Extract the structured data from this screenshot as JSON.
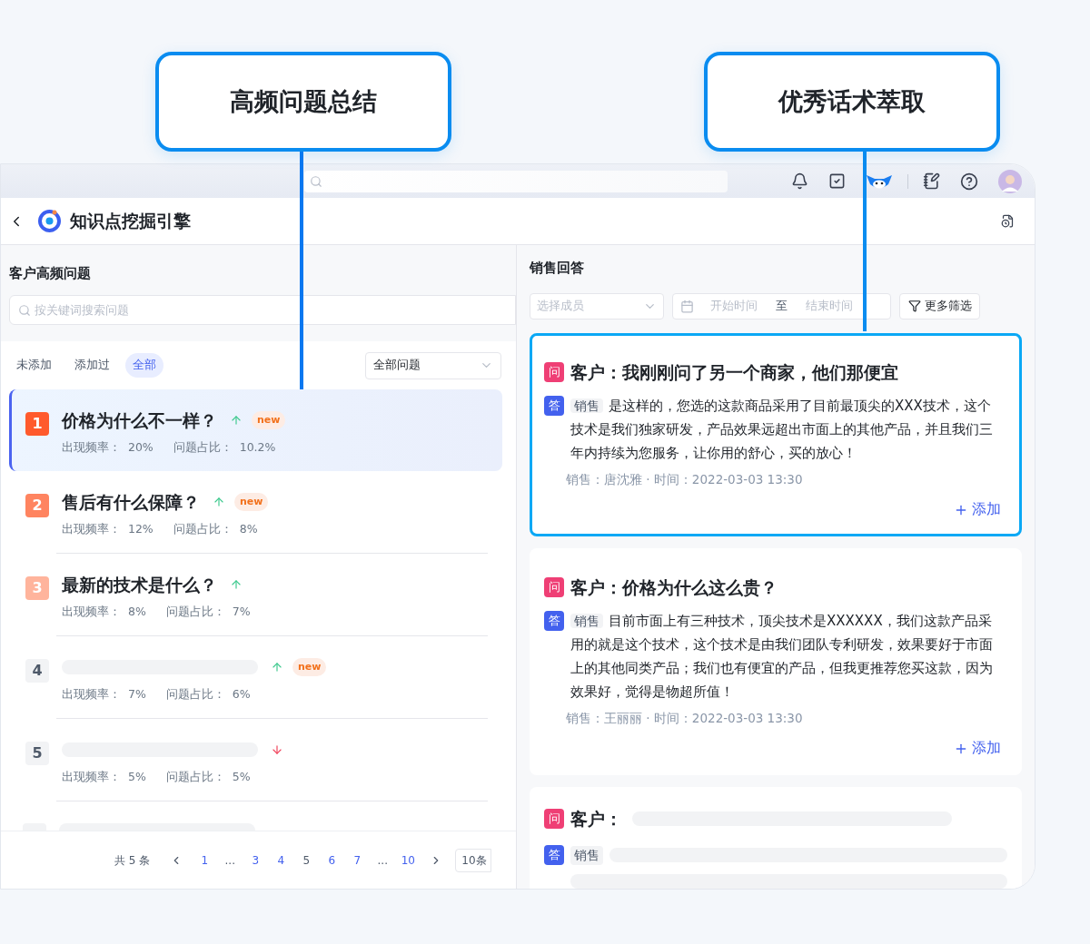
{
  "callouts": [
    {
      "label": "高频问题总结"
    },
    {
      "label": "优秀话术萃取"
    }
  ],
  "app_header": {
    "title": "知识点挖掘引擎"
  },
  "questions_panel": {
    "title": "客户高频问题",
    "search": {
      "placeholder": "按关键词搜索问题"
    },
    "tabs": [
      {
        "label": "未添加",
        "selected": false
      },
      {
        "label": "添加过",
        "selected": false
      },
      {
        "label": "全部",
        "selected": true
      }
    ],
    "filter": {
      "value": "全部问题"
    },
    "items": [
      {
        "kind": "question",
        "rank": "1",
        "title": "价格为什么不一样？",
        "rising": true,
        "badge": "new",
        "frequency": "出现频率：  20%",
        "share": "问题占比：  10.2%",
        "selected": true
      },
      {
        "kind": "question",
        "rank": "2",
        "title": "售后有什么保障？",
        "rising": true,
        "badge": "new",
        "frequency": "出现频率：  12%",
        "share": "问题占比：  8%",
        "selected": false
      },
      {
        "kind": "question",
        "rank": "3",
        "title": "最新的技术是什么？",
        "rising": true,
        "frequency": "出现频率：  8%",
        "share": "问题占比：  7%",
        "selected": false
      },
      {
        "kind": "skeleton",
        "rank": "4",
        "rising": true,
        "badge": "new",
        "frequency": "出现频率：  7%",
        "share": "问题占比：  6%",
        "selected": false
      },
      {
        "kind": "skeleton",
        "rank": "5",
        "rising": false,
        "frequency": "出现频率：  5%",
        "share": "问题占比：  5%",
        "selected": false
      },
      {
        "kind": "partial"
      }
    ],
    "pagination": {
      "total": "共 5 条",
      "pages": [
        {
          "kind": "page",
          "label": "1",
          "selected": false
        },
        {
          "kind": "ellipsis",
          "label": "..."
        },
        {
          "kind": "page",
          "label": "3",
          "selected": false
        },
        {
          "kind": "page",
          "label": "4",
          "selected": false
        },
        {
          "kind": "page",
          "label": "5",
          "selected": true
        },
        {
          "kind": "page",
          "label": "6",
          "selected": false
        },
        {
          "kind": "page",
          "label": "7",
          "selected": false
        },
        {
          "kind": "ellipsis",
          "label": "..."
        },
        {
          "kind": "page",
          "label": "10",
          "selected": false
        }
      ],
      "page_size": "10条"
    }
  },
  "answers_panel": {
    "title": "销售回答",
    "member_select": {
      "placeholder": "选择成员"
    },
    "date_range": {
      "start": "开始时间",
      "separator": "至",
      "end": "结束时间"
    },
    "more_filter": "更多筛选",
    "cards": [
      {
        "kind": "full",
        "selected": true,
        "q_badge": "问",
        "question": "客户：我刚刚问了另一个商家，他们那便宜",
        "a_badge": "答",
        "tag": "销售",
        "answer": "是这样的，您选的这款商品采用了目前最顶尖的XXX技术，这个技术是我们独家研发，产品效果远超出市面上的其他产品，并且我们三年内持续为您服务，让你用的舒心，买的放心！",
        "meta": "销售：唐沈雅 · 时间：2022-03-03 13:30",
        "add": "添加"
      },
      {
        "kind": "full",
        "selected": false,
        "q_badge": "问",
        "question": "客户：价格为什么这么贵？",
        "a_badge": "答",
        "tag": "销售",
        "answer": "目前市面上有三种技术，顶尖技术是XXXXXX，我们这款产品采用的就是这个技术，这个技术是由我们团队专利研发，效果要好于市面上的其他同类产品；我们也有便宜的产品，但我更推荐您买这款，因为效果好，觉得是物超所值！",
        "meta": "销售：王丽丽 · 时间：2022-03-03 13:30",
        "add": "添加"
      },
      {
        "kind": "skeleton",
        "selected": false,
        "q_badge": "问",
        "question": "客户：",
        "a_badge": "答",
        "tag": "销售"
      }
    ]
  }
}
